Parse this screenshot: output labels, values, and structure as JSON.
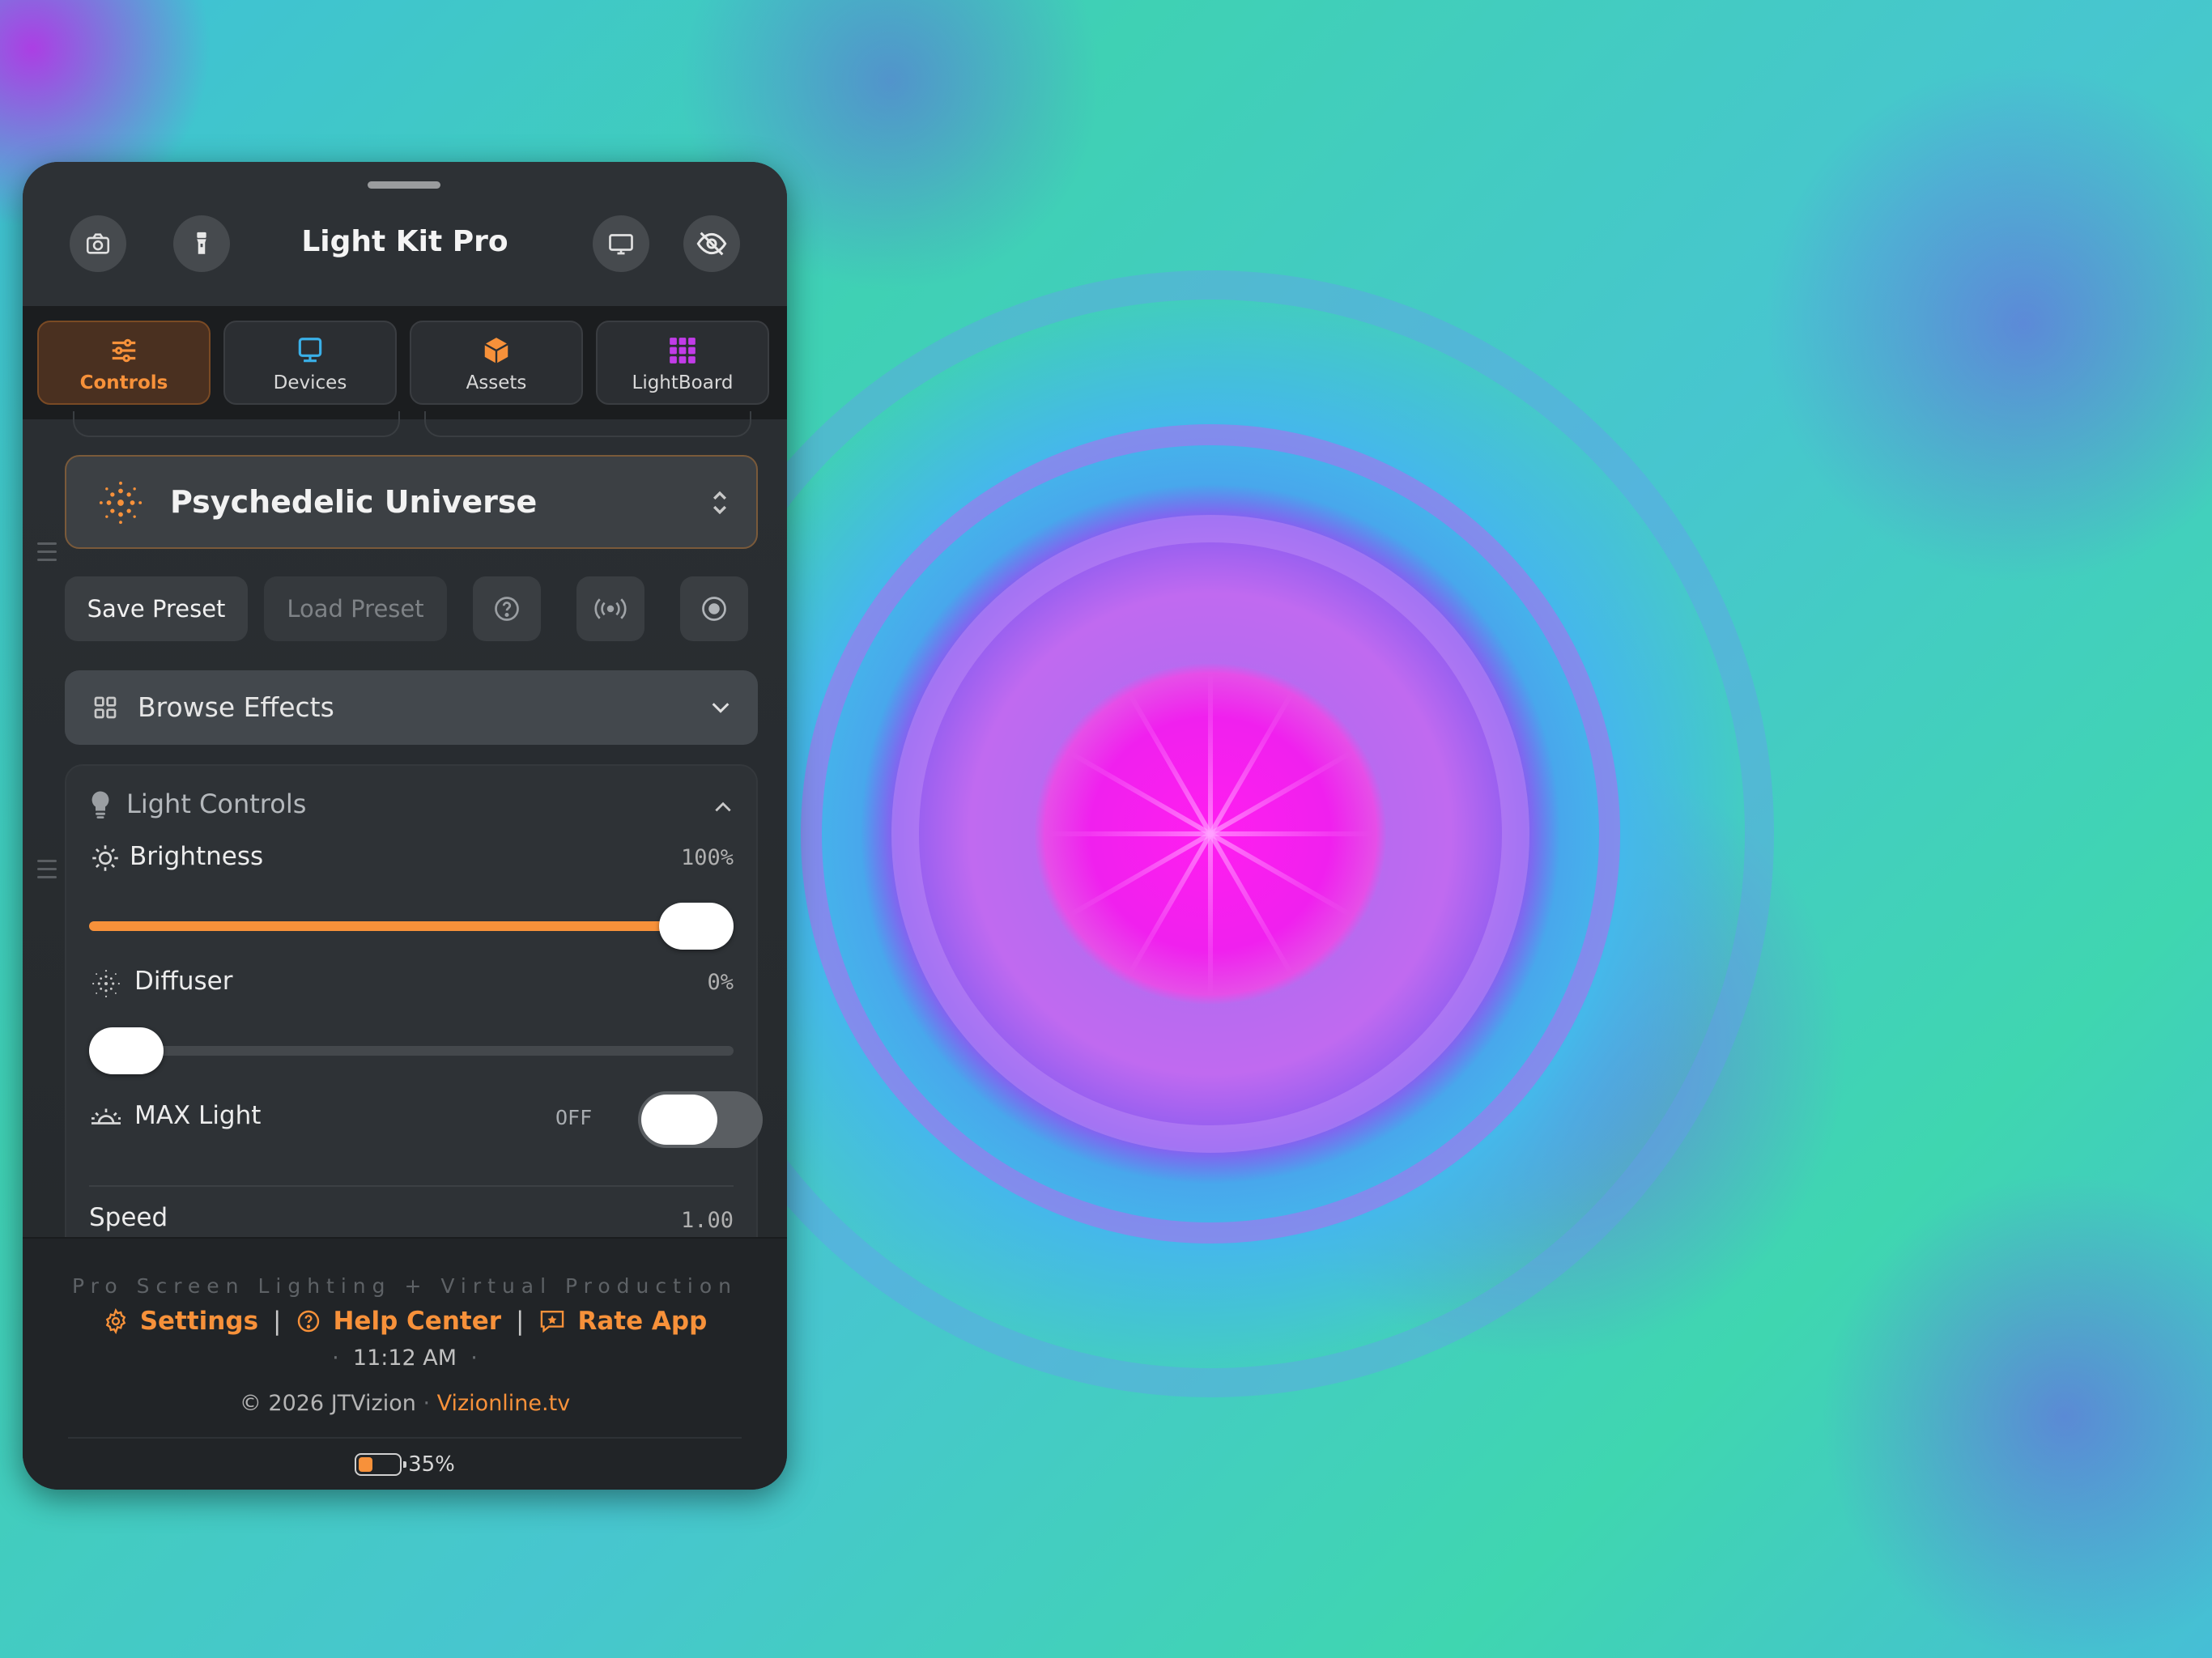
{
  "app": {
    "title": "Light Kit Pro"
  },
  "header": {
    "left_icons": [
      "camera-icon",
      "flashlight-icon"
    ],
    "right_icons": [
      "display-icon",
      "eye-slash-icon"
    ]
  },
  "tabs": [
    {
      "label": "Controls",
      "icon": "sliders-icon",
      "active": true
    },
    {
      "label": "Devices",
      "icon": "monitor-icon",
      "active": false
    },
    {
      "label": "Assets",
      "icon": "box-icon",
      "active": false
    },
    {
      "label": "LightBoard",
      "icon": "grid-icon",
      "active": false
    }
  ],
  "preset": {
    "name": "Psychedelic Universe",
    "icon": "dots-burst-icon"
  },
  "actions": {
    "save_label": "Save Preset",
    "load_label": "Load Preset",
    "icons": [
      "help-icon",
      "broadcast-icon",
      "record-icon"
    ]
  },
  "browse": {
    "label": "Browse Effects"
  },
  "light_controls": {
    "title": "Light Controls",
    "brightness": {
      "label": "Brightness",
      "value_text": "100%",
      "value": 1.0
    },
    "diffuser": {
      "label": "Diffuser",
      "value_text": "0%",
      "value": 0.0
    },
    "max_light": {
      "label": "MAX Light",
      "state": "OFF",
      "on": false
    },
    "speed": {
      "label": "Speed",
      "value_text": "1.00"
    }
  },
  "footer": {
    "tagline": "Pro Screen Lighting + Virtual Production",
    "settings": "Settings",
    "help": "Help Center",
    "rate": "Rate App",
    "separator": "|",
    "time": "11:12 AM",
    "copyright": "© 2026 JTVizion",
    "website": "Vizionline.tv",
    "battery": "35%",
    "battery_level": 0.35
  },
  "colors": {
    "accent": "#f7913a",
    "panel": "#24282c",
    "background_center": "#ff1ef0",
    "background_outer": "#3fd1b4"
  }
}
